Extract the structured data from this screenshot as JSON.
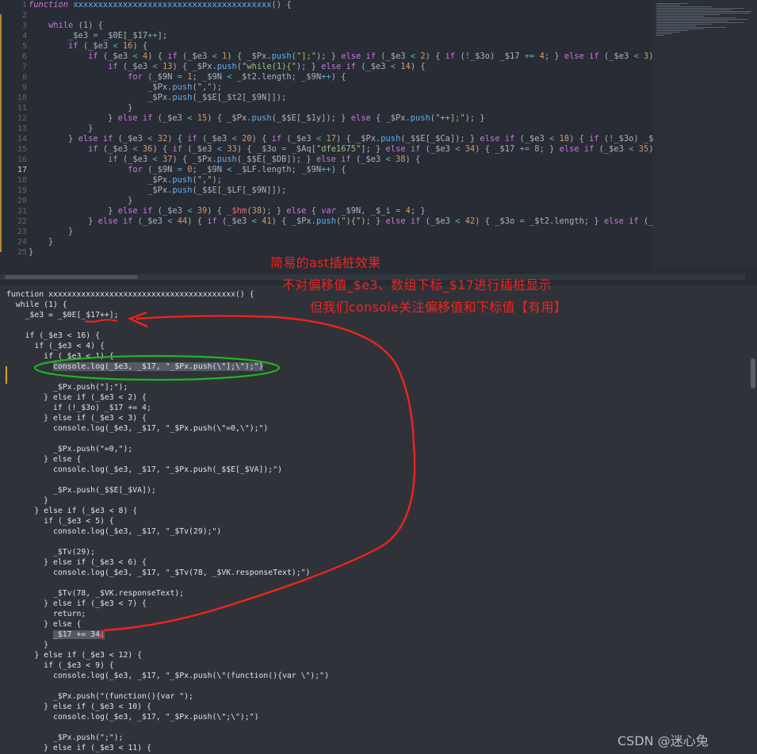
{
  "top_editor": {
    "line_numbers": [
      "1",
      "2",
      "3",
      "4",
      "5",
      "6",
      "7",
      "8",
      "9",
      "10",
      "11",
      "12",
      "13",
      "14",
      "15",
      "16",
      "17",
      "18",
      "19",
      "20",
      "21",
      "22",
      "23",
      "24",
      "25"
    ],
    "active_line": "17"
  },
  "bottom_code": [
    "function xxxxxxxxxxxxxxxxxxxxxxxxxxxxxxxxxxxxxxxx() {",
    "  while (1) {",
    "    _$e3 = _$0E[_$17++];",
    "",
    "    if (_$e3 < 16) {",
    "      if (_$e3 < 4) {",
    "        if (_$e3 < 1) {",
    "          console.log(_$e3, _$17, \"_$Px.push(\\\"];\\\");\")",
    "",
    "          _$Px.push(\"];\");",
    "        } else if (_$e3 < 2) {",
    "          if (!_$3o) _$17 += 4;",
    "        } else if (_$e3 < 3) {",
    "          console.log(_$e3, _$17, \"_$Px.push(\\\"=0,\\\");\")",
    "",
    "          _$Px.push(\"=0,\");",
    "        } else {",
    "          console.log(_$e3, _$17, \"_$Px.push(_$$E[_$VA]);\")",
    "",
    "          _$Px.push(_$$E[_$VA]);",
    "        }",
    "      } else if (_$e3 < 8) {",
    "        if (_$e3 < 5) {",
    "          console.log(_$e3, _$17, \"_$Tv(29);\")",
    "",
    "          _$Tv(29);",
    "        } else if (_$e3 < 6) {",
    "          console.log(_$e3, _$17, \"_$Tv(78, _$VK.responseText);\")",
    "",
    "          _$Tv(78, _$VK.responseText);",
    "        } else if (_$e3 < 7) {",
    "          return;",
    "        } else {",
    "          _$17 += 34;",
    "        }",
    "      } else if (_$e3 < 12) {",
    "        if (_$e3 < 9) {",
    "          console.log(_$e3, _$17, \"_$Px.push(\\\"(function(){var \\\");\")",
    "",
    "          _$Px.push(\"(function(){var \");",
    "        } else if (_$e3 < 10) {",
    "          console.log(_$e3, _$17, \"_$Px.push(\\\";\\\");\")",
    "",
    "          _$Px.push(\";\");",
    "        } else if (_$e3 < 11) {"
  ],
  "annotations": {
    "line1": "简易的ast插桩效果",
    "line2": "不对偏移值_$e3、数组下标_$17进行插桩显示",
    "line3": "但我们console关注偏移值和下标值【有用】"
  },
  "watermark": "CSDN @迷心兔",
  "colors": {
    "annotation": "#f0231e",
    "highlight_circle": "#1fb51f",
    "change_marker": "#d4a627"
  }
}
